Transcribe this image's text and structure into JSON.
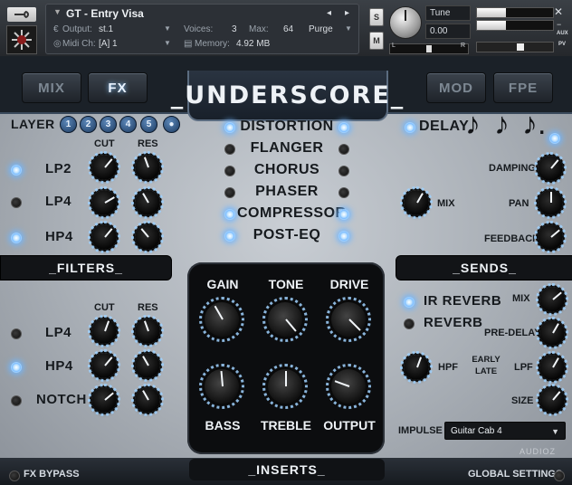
{
  "header": {
    "instrument_name": "GT - Entry Visa",
    "output_label": "Output:",
    "output_value": "st.1",
    "midi_label": "Midi Ch:",
    "midi_value": "[A] 1",
    "voices_label": "Voices:",
    "voices_value": "3",
    "max_label": "Max:",
    "max_value": "64",
    "memory_label": "Memory:",
    "memory_value": "4.92 MB",
    "purge_label": "Purge",
    "solo_label": "S",
    "mute_label": "M",
    "tune_label": "Tune",
    "tune_value": "0.00",
    "pan_left": "L",
    "pan_right": "R",
    "aux_label": "AUX",
    "pv_label": "PV",
    "arrow_left": "◂",
    "arrow_right": "▸"
  },
  "tabs": {
    "mix": "MIX",
    "fx": "FX",
    "mod": "MOD",
    "fpe": "FPE",
    "active": "FX"
  },
  "title": "_UNDERSCORE_",
  "layer": {
    "label": "LAYER",
    "buttons": [
      "1",
      "2",
      "3",
      "4",
      "5",
      "●"
    ]
  },
  "filters": {
    "cut_label": "CUT",
    "res_label": "RES",
    "top_rows": [
      {
        "name": "LP2",
        "on": true
      },
      {
        "name": "LP4",
        "on": false
      },
      {
        "name": "HP4",
        "on": true
      }
    ],
    "bottom_rows": [
      {
        "name": "LP4",
        "on": false
      },
      {
        "name": "HP4",
        "on": true
      },
      {
        "name": "NOTCH",
        "on": false
      }
    ],
    "section_label": "_FILTERS_"
  },
  "fx_list": [
    {
      "name": "DISTORTION",
      "on": true
    },
    {
      "name": "FLANGER",
      "on": false
    },
    {
      "name": "CHORUS",
      "on": false
    },
    {
      "name": "PHASER",
      "on": false
    },
    {
      "name": "COMPRESSOR",
      "on": true
    },
    {
      "name": "POST-EQ",
      "on": true
    }
  ],
  "inserts": {
    "top_labels": [
      "GAIN",
      "TONE",
      "DRIVE"
    ],
    "bottom_labels": [
      "BASS",
      "TREBLE",
      "OUTPUT"
    ],
    "section_label": "_INSERTS_"
  },
  "delay": {
    "label": "DELAY",
    "notes": [
      "♪",
      "♪",
      "♪."
    ],
    "mix_label": "MIX",
    "damping_label": "DAMPING",
    "pan_label": "PAN",
    "feedback_label": "FEEDBACK"
  },
  "sends": {
    "section_label": "_SENDS_",
    "ir_reverb_label": "IR REVERB",
    "reverb_label": "REVERB",
    "mix_label": "MIX",
    "predelay_label": "PRE-DELAY",
    "hpf_label": "HPF",
    "early_label": "EARLY",
    "late_label": "LATE",
    "lpf_label": "LPF",
    "size_label": "SIZE",
    "impulse_label": "IMPULSE",
    "impulse_value": "Guitar Cab 4"
  },
  "footer": {
    "fx_bypass": "FX BYPASS",
    "global_settings": "GLOBAL SETTINGS",
    "watermark": "AUDIOZ"
  }
}
